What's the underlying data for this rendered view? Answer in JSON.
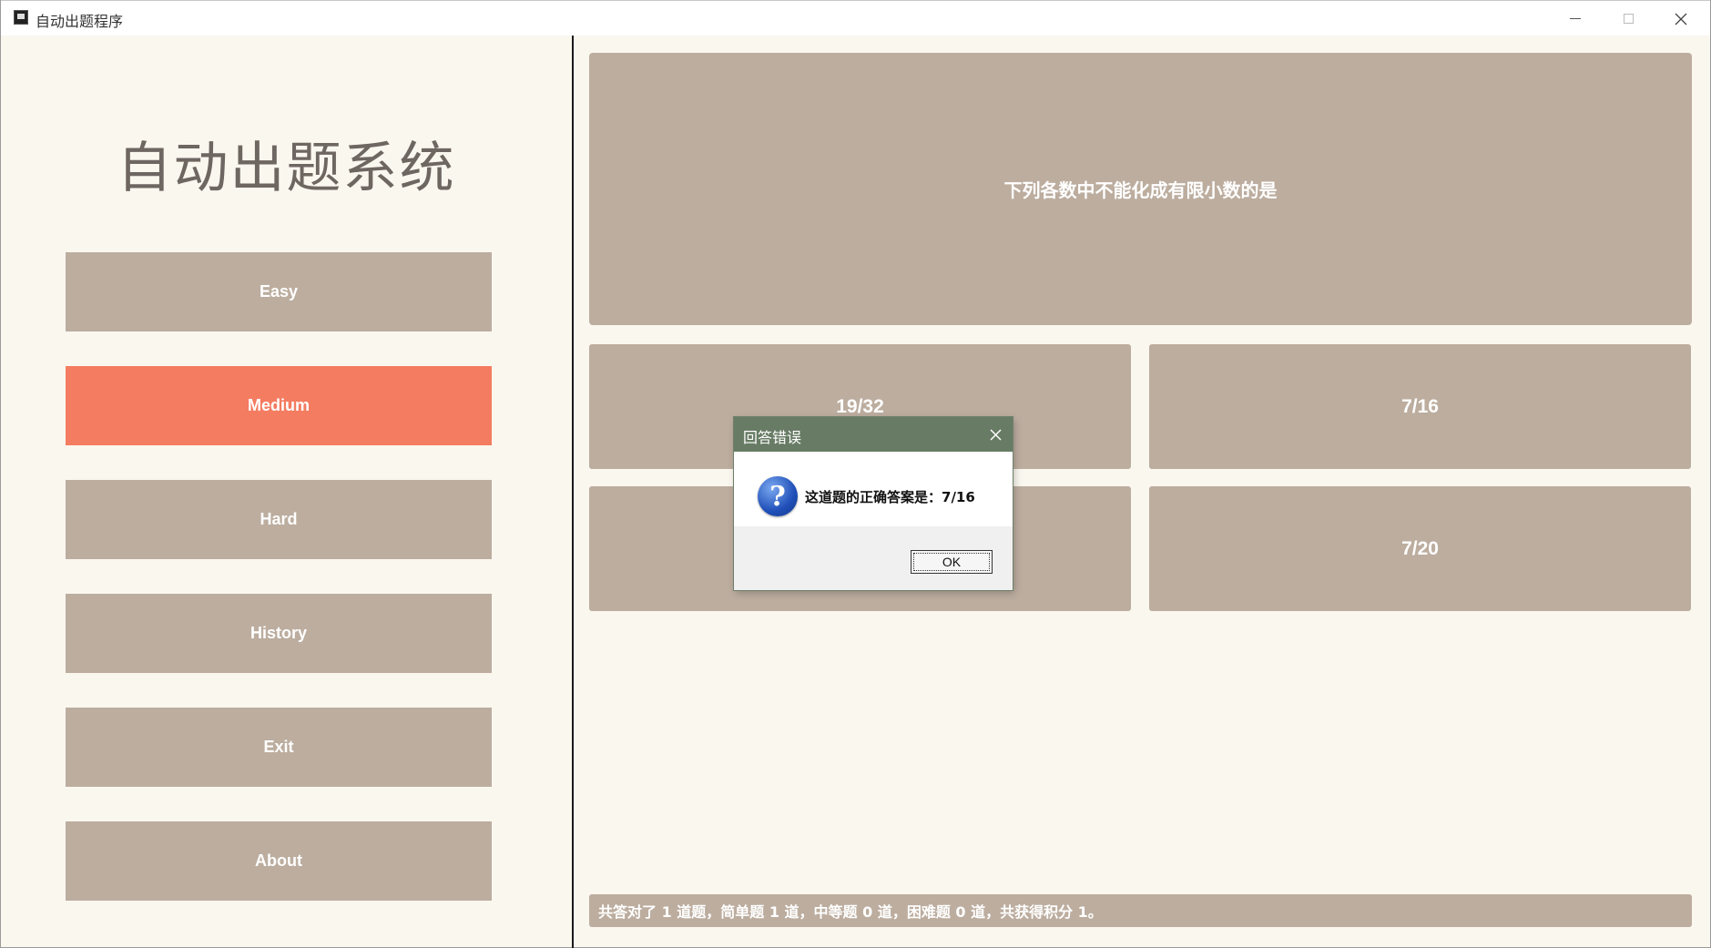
{
  "window": {
    "title": "自动出题程序"
  },
  "sidebar": {
    "title": "自动出题系统",
    "buttons": [
      {
        "label": "Easy",
        "active": false
      },
      {
        "label": "Medium",
        "active": true
      },
      {
        "label": "Hard",
        "active": false
      },
      {
        "label": "History",
        "active": false
      },
      {
        "label": "Exit",
        "active": false
      },
      {
        "label": "About",
        "active": false
      }
    ]
  },
  "quiz": {
    "question": "下列各数中不能化成有限小数的是",
    "options": [
      "19/32",
      "7/16",
      "",
      "7/20"
    ],
    "status": "共答对了 1 道题，简单题 1 道，中等题 0 道，困难题 0 道，共获得积分 1。"
  },
  "dialog": {
    "title": "回答错误",
    "message": "这道题的正确答案是：7/16",
    "ok_label": "OK",
    "icon": "question-icon"
  },
  "colors": {
    "background": "#faf7ef",
    "button": "#bcad9f",
    "active_button": "#f47c61",
    "dialog_title": "#687c65"
  }
}
